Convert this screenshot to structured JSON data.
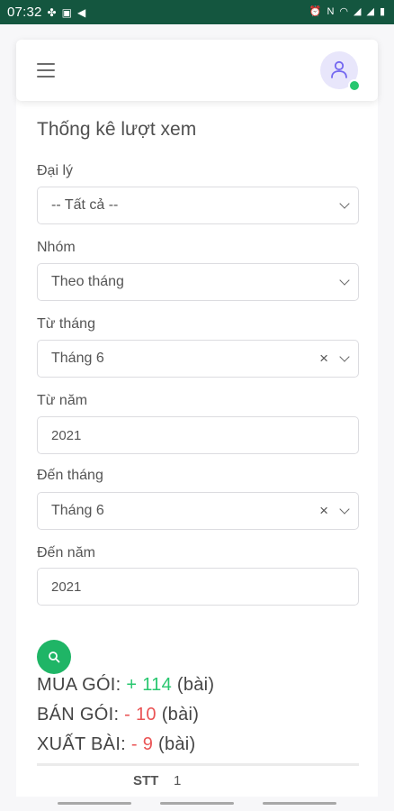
{
  "statusbar": {
    "time": "07:32",
    "left_icons": [
      "fan-icon",
      "image-icon",
      "send-icon"
    ],
    "right_icons": [
      "alarm-icon",
      "nfc-icon",
      "wifi-icon",
      "signal-icon",
      "signal-icon",
      "battery-icon"
    ]
  },
  "page": {
    "title": "Thống kê lượt xem"
  },
  "form": {
    "agent_label": "Đại lý",
    "agent_value": "-- Tất cả --",
    "group_label": "Nhóm",
    "group_value": "Theo tháng",
    "from_month_label": "Từ tháng",
    "from_month_value": "Tháng 6",
    "from_year_label": "Từ năm",
    "from_year_value": "2021",
    "to_month_label": "Đến tháng",
    "to_month_value": "Tháng 6",
    "to_year_label": "Đến năm",
    "to_year_value": "2021",
    "clear_symbol": "×"
  },
  "stats": {
    "buy_label": "MUA GÓI: ",
    "buy_value": "+ 114",
    "sell_label": "BÁN GÓI: ",
    "sell_value": "- 10",
    "export_label": "XUẤT BÀI: ",
    "export_value": "- 9",
    "unit": " (bài)"
  },
  "table": {
    "stt_label": "STT",
    "stt_value": "1"
  },
  "colors": {
    "statusbar": "#14563f",
    "accent_green": "#1fb566",
    "positive": "#28c76f",
    "negative": "#ea5455",
    "avatar_bg": "#e8e6fb"
  }
}
